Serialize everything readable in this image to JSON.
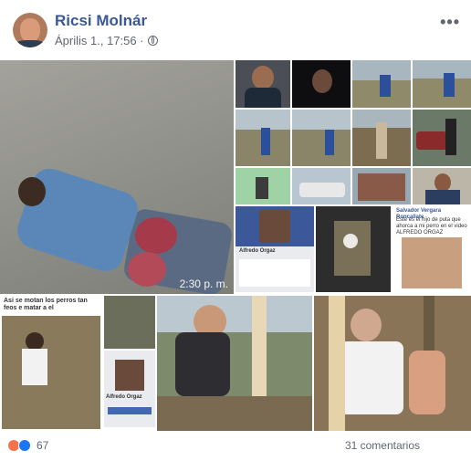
{
  "post": {
    "author": "Ricsi Molnár",
    "timestamp": "Április 1., 17:56 ·",
    "more_label": "•••"
  },
  "main_image": {
    "time_overlay": "2:30 p. m."
  },
  "bottom_left": {
    "caption": "Asi se motan los perros tan feos e matar a el",
    "profile_name": "Alfredo Orgaz"
  },
  "grid": {
    "profile_name": "Alfredo Orgaz",
    "post_author": "Salvador Vergara Roncallate",
    "post_text": "Este es el hijo de puta que ahorca a mi perro en el video ALFREDO ORGAZ"
  },
  "footer": {
    "reaction_count": "67",
    "comments": "31 comentarios"
  },
  "colors": {
    "name": "#385898",
    "meta": "#606770",
    "like": "#1877f2",
    "angry": "#f7714c"
  }
}
